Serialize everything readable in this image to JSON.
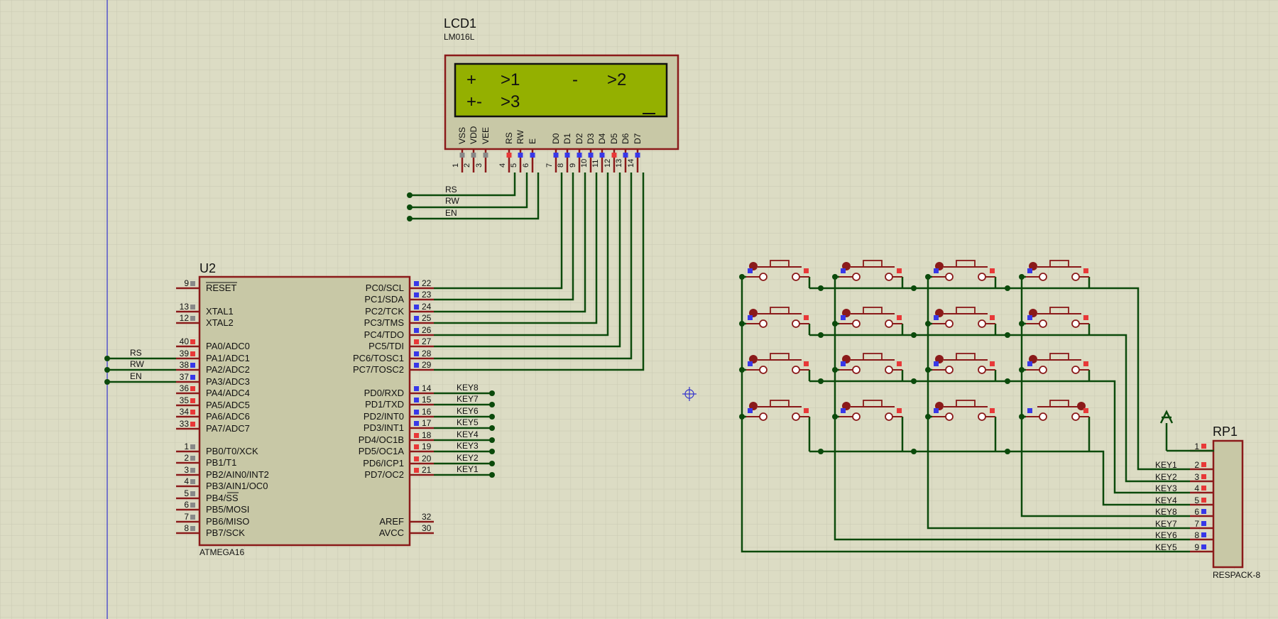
{
  "colors": {
    "background": "#dcdcc4",
    "grid": "#c9c9b2",
    "wire": "#0b4a0b",
    "body_outline": "#8b1a1a",
    "body_fill": "#c8c8a6",
    "lcd_screen": "#94b000",
    "pin_red": "#e83838",
    "pin_blue": "#3838e8",
    "pin_gray": "#888888"
  },
  "lcd": {
    "ref": "LCD1",
    "part": "LM016L",
    "line1_segments": [
      "+",
      ">1",
      "-",
      ">2"
    ],
    "line2_segments": [
      "+-",
      ">3"
    ],
    "pins": [
      {
        "num": "1",
        "name": "VSS"
      },
      {
        "num": "2",
        "name": "VDD"
      },
      {
        "num": "3",
        "name": "VEE"
      },
      {
        "num": "4",
        "name": "RS"
      },
      {
        "num": "5",
        "name": "RW"
      },
      {
        "num": "6",
        "name": "E"
      },
      {
        "num": "7",
        "name": "D0"
      },
      {
        "num": "8",
        "name": "D1"
      },
      {
        "num": "9",
        "name": "D2"
      },
      {
        "num": "10",
        "name": "D3"
      },
      {
        "num": "11",
        "name": "D4"
      },
      {
        "num": "12",
        "name": "D5"
      },
      {
        "num": "13",
        "name": "D6"
      },
      {
        "num": "14",
        "name": "D7"
      }
    ]
  },
  "lcd_ctrl_labels": [
    "RS",
    "RW",
    "EN"
  ],
  "mcu": {
    "ref": "U2",
    "part": "ATMEGA16",
    "left_pins": [
      {
        "num": "9",
        "name": "RESET"
      },
      {
        "num": "13",
        "name": "XTAL1"
      },
      {
        "num": "12",
        "name": "XTAL2"
      },
      {
        "num": "40",
        "name": "PA0/ADC0"
      },
      {
        "num": "39",
        "name": "PA1/ADC1"
      },
      {
        "num": "38",
        "name": "PA2/ADC2"
      },
      {
        "num": "37",
        "name": "PA3/ADC3"
      },
      {
        "num": "36",
        "name": "PA4/ADC4"
      },
      {
        "num": "35",
        "name": "PA5/ADC5"
      },
      {
        "num": "34",
        "name": "PA6/ADC6"
      },
      {
        "num": "33",
        "name": "PA7/ADC7"
      },
      {
        "num": "1",
        "name": "PB0/T0/XCK"
      },
      {
        "num": "2",
        "name": "PB1/T1"
      },
      {
        "num": "3",
        "name": "PB2/AIN0/INT2"
      },
      {
        "num": "4",
        "name": "PB3/AIN1/OC0"
      },
      {
        "num": "5",
        "name": "PB4/SS"
      },
      {
        "num": "6",
        "name": "PB5/MOSI"
      },
      {
        "num": "7",
        "name": "PB6/MISO"
      },
      {
        "num": "8",
        "name": "PB7/SCK"
      }
    ],
    "right_pins": [
      {
        "num": "22",
        "name": "PC0/SCL"
      },
      {
        "num": "23",
        "name": "PC1/SDA"
      },
      {
        "num": "24",
        "name": "PC2/TCK"
      },
      {
        "num": "25",
        "name": "PC3/TMS"
      },
      {
        "num": "26",
        "name": "PC4/TDO"
      },
      {
        "num": "27",
        "name": "PC5/TDI"
      },
      {
        "num": "28",
        "name": "PC6/TOSC1"
      },
      {
        "num": "29",
        "name": "PC7/TOSC2"
      },
      {
        "num": "14",
        "name": "PD0/RXD"
      },
      {
        "num": "15",
        "name": "PD1/TXD"
      },
      {
        "num": "16",
        "name": "PD2/INT0"
      },
      {
        "num": "17",
        "name": "PD3/INT1"
      },
      {
        "num": "18",
        "name": "PD4/OC1B"
      },
      {
        "num": "19",
        "name": "PD5/OC1A"
      },
      {
        "num": "20",
        "name": "PD6/ICP1"
      },
      {
        "num": "21",
        "name": "PD7/OC2"
      },
      {
        "num": "32",
        "name": "AREF"
      },
      {
        "num": "30",
        "name": "AVCC"
      }
    ],
    "porta_wire_labels": [
      "RS",
      "RW",
      "EN"
    ],
    "portd_key_labels": [
      "KEY8",
      "KEY7",
      "KEY6",
      "KEY5",
      "KEY4",
      "KEY3",
      "KEY2",
      "KEY1"
    ]
  },
  "rpack": {
    "ref": "RP1",
    "part": "RESPACK-8",
    "pins": [
      {
        "num": "1",
        "label": ""
      },
      {
        "num": "2",
        "label": "KEY1"
      },
      {
        "num": "3",
        "label": "KEY2"
      },
      {
        "num": "4",
        "label": "KEY3"
      },
      {
        "num": "5",
        "label": "KEY4"
      },
      {
        "num": "6",
        "label": "KEY8"
      },
      {
        "num": "7",
        "label": "KEY7"
      },
      {
        "num": "8",
        "label": "KEY6"
      },
      {
        "num": "9",
        "label": "KEY5"
      }
    ]
  },
  "keypad": {
    "rows": 4,
    "cols": 4
  }
}
